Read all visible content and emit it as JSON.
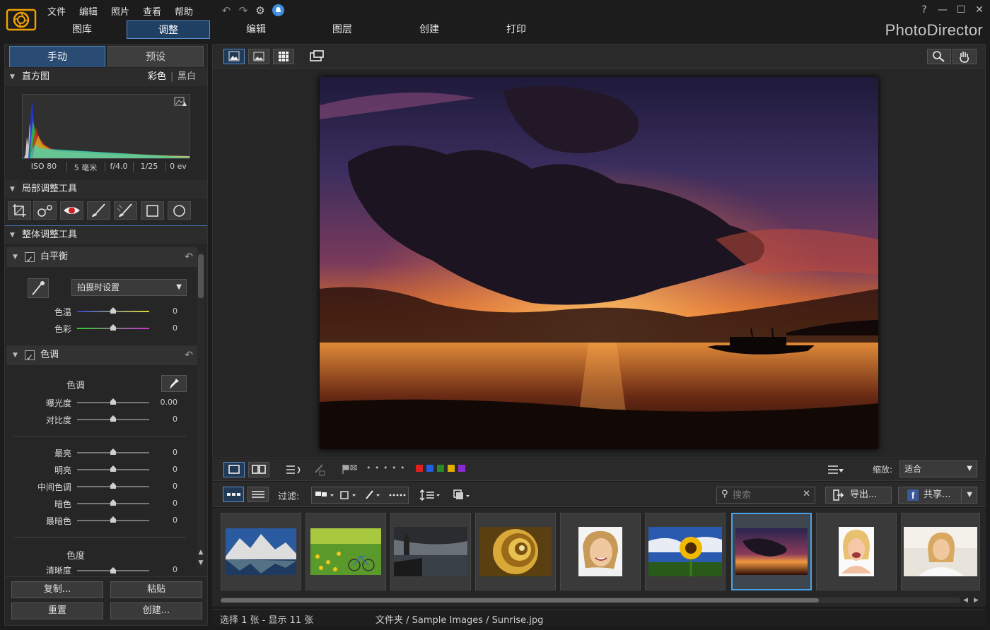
{
  "menu": [
    "文件",
    "编辑",
    "照片",
    "查看",
    "帮助"
  ],
  "main_tabs": [
    "图库",
    "调整",
    "编辑",
    "图层",
    "创建",
    "打印"
  ],
  "active_main_tab": 1,
  "brand": "PhotoDirector",
  "window_help": "?",
  "left_tabs": {
    "manual": "手动",
    "preset": "预设"
  },
  "histogram": {
    "title": "直方图",
    "mode_color": "彩色",
    "mode_sep": "|",
    "mode_bw": "黑白",
    "exif": [
      "ISO 80",
      "5 毫米",
      "f/4.0",
      "1/25",
      "0 ev"
    ]
  },
  "local_tools": {
    "title": "局部调整工具"
  },
  "global_tools": {
    "title": "整体调整工具"
  },
  "white_balance": {
    "title": "白平衡",
    "preset": "拍摄时设置",
    "sliders": [
      {
        "label": "色温",
        "value": "0"
      },
      {
        "label": "色彩",
        "value": "0"
      }
    ]
  },
  "tone": {
    "title": "色调",
    "sub_title": "色调",
    "sliders": [
      {
        "label": "曝光度",
        "value": "0.00"
      },
      {
        "label": "对比度",
        "value": "0"
      }
    ],
    "sliders2": [
      {
        "label": "最亮",
        "value": "0"
      },
      {
        "label": "明亮",
        "value": "0"
      },
      {
        "label": "中间色调",
        "value": "0"
      },
      {
        "label": "暗色",
        "value": "0"
      },
      {
        "label": "最暗色",
        "value": "0"
      }
    ],
    "chroma_title": "色度",
    "clarity": {
      "label": "清晰度",
      "value": "0"
    }
  },
  "left_buttons": {
    "copy": "复制...",
    "paste": "粘贴",
    "reset": "重置",
    "create": "创建..."
  },
  "viewer_bar": {
    "zoom_label": "缩放:",
    "zoom_value": "适合",
    "rating_dots": "• • • • •",
    "colors": [
      "#e02020",
      "#1f5fe0",
      "#2a8a2a",
      "#e0b000",
      "#8a2ad0"
    ]
  },
  "filter_bar": {
    "filter_label": "过滤:",
    "search_placeholder": "搜索",
    "export": "导出...",
    "share": "共享..."
  },
  "status": {
    "selection": "选择 1 张 - 显示 11 张",
    "path": "文件夹 / Sample Images / Sunrise.jpg"
  }
}
